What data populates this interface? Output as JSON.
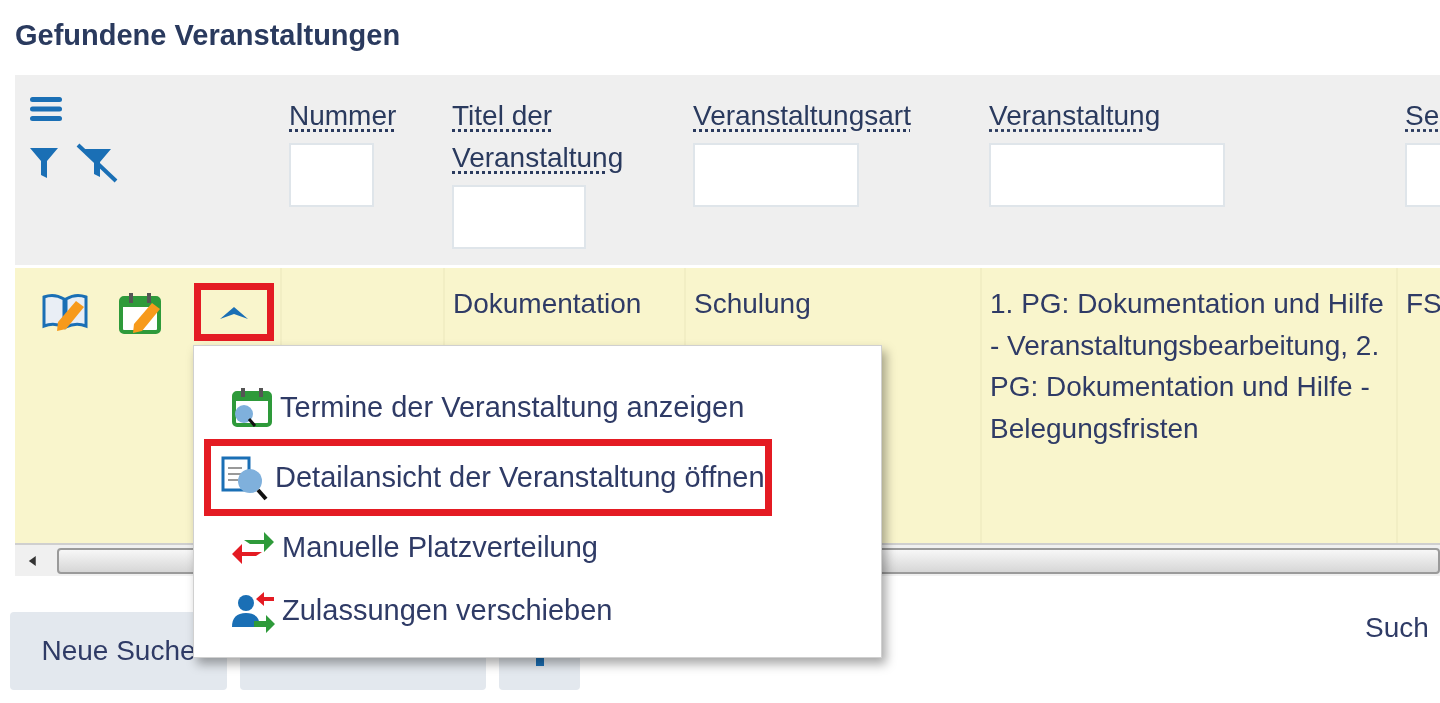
{
  "title": "Gefundene Veranstaltungen",
  "table": {
    "columns": [
      {
        "label": "Nummer"
      },
      {
        "label": "Titel der Veranstaltung"
      },
      {
        "label": "Veranstaltungsart"
      },
      {
        "label": "Veranstaltung"
      },
      {
        "label": "Se"
      }
    ],
    "rows": [
      {
        "expanded": true,
        "cells": [
          "",
          "Dokumentation",
          "Schulung",
          "1. PG: Dokumentation und Hilfe - Veranstaltungsbearbeitung, 2. PG: Dokumentation und Hilfe - Belegungsfristen",
          "FS"
        ]
      }
    ]
  },
  "context_menu": {
    "items": [
      {
        "kind": "dates",
        "label": "Termine der Veranstaltung anzeigen",
        "selected": false
      },
      {
        "kind": "details",
        "label": "Detailansicht der Veranstaltung öffnen",
        "selected": true
      },
      {
        "kind": "distribute",
        "label": "Manuelle Platzverteilung",
        "selected": false
      },
      {
        "kind": "move",
        "label": "Zulassungen verschieben",
        "selected": false
      }
    ]
  },
  "buttons": [
    {
      "label": "Neue Suche"
    }
  ],
  "search_label": "Such"
}
